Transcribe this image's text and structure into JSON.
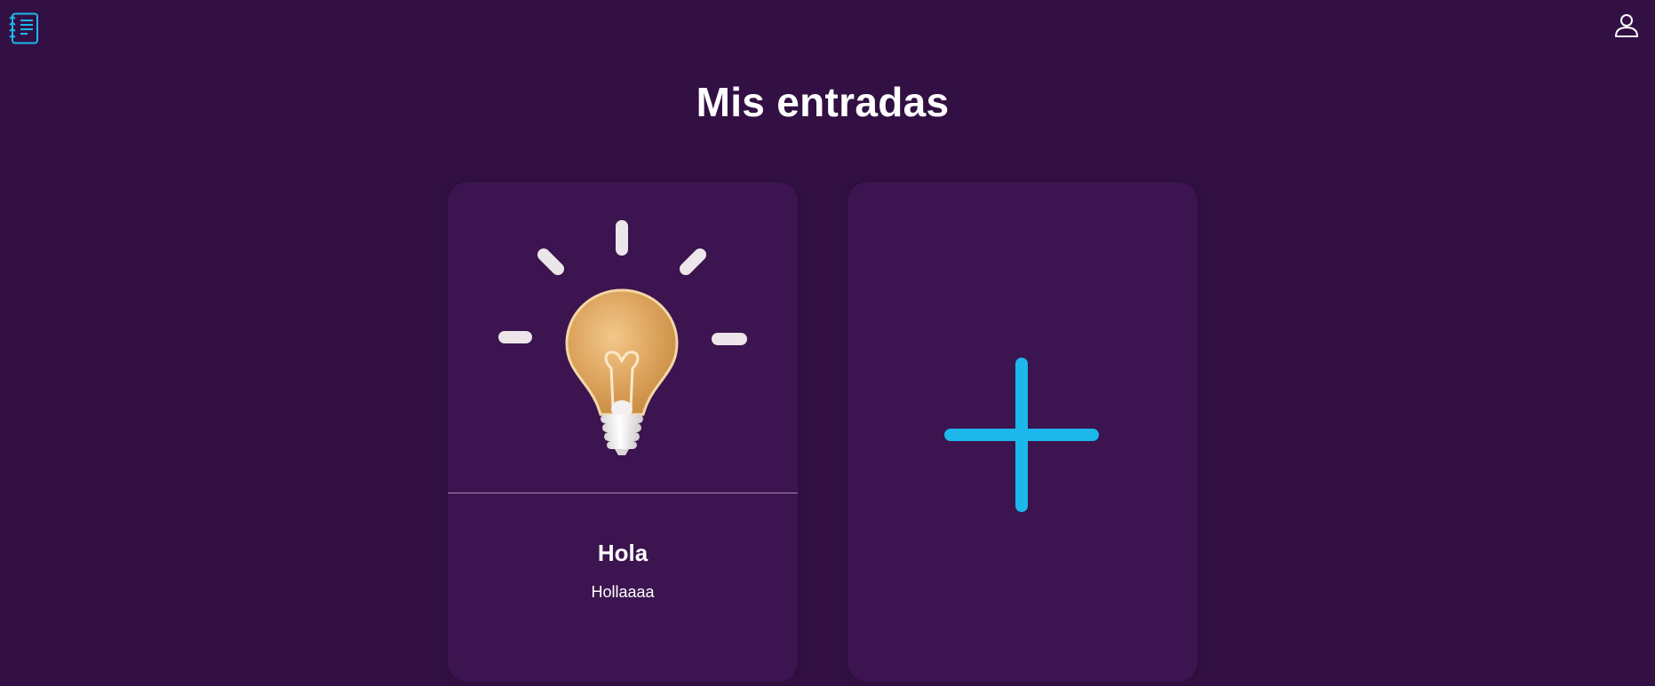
{
  "header": {
    "logo_icon": "notebook-list-icon",
    "user_icon": "user-icon",
    "accent_color": "#1cb8ec"
  },
  "main": {
    "title": "Mis entradas"
  },
  "entries": [
    {
      "icon": "lightbulb-image",
      "title": "Hola",
      "text": "Hollaaaa"
    }
  ],
  "add_card": {
    "icon": "plus-icon"
  },
  "colors": {
    "background": "#321044",
    "card": "#3c144f",
    "accent": "#1cb8ec"
  }
}
